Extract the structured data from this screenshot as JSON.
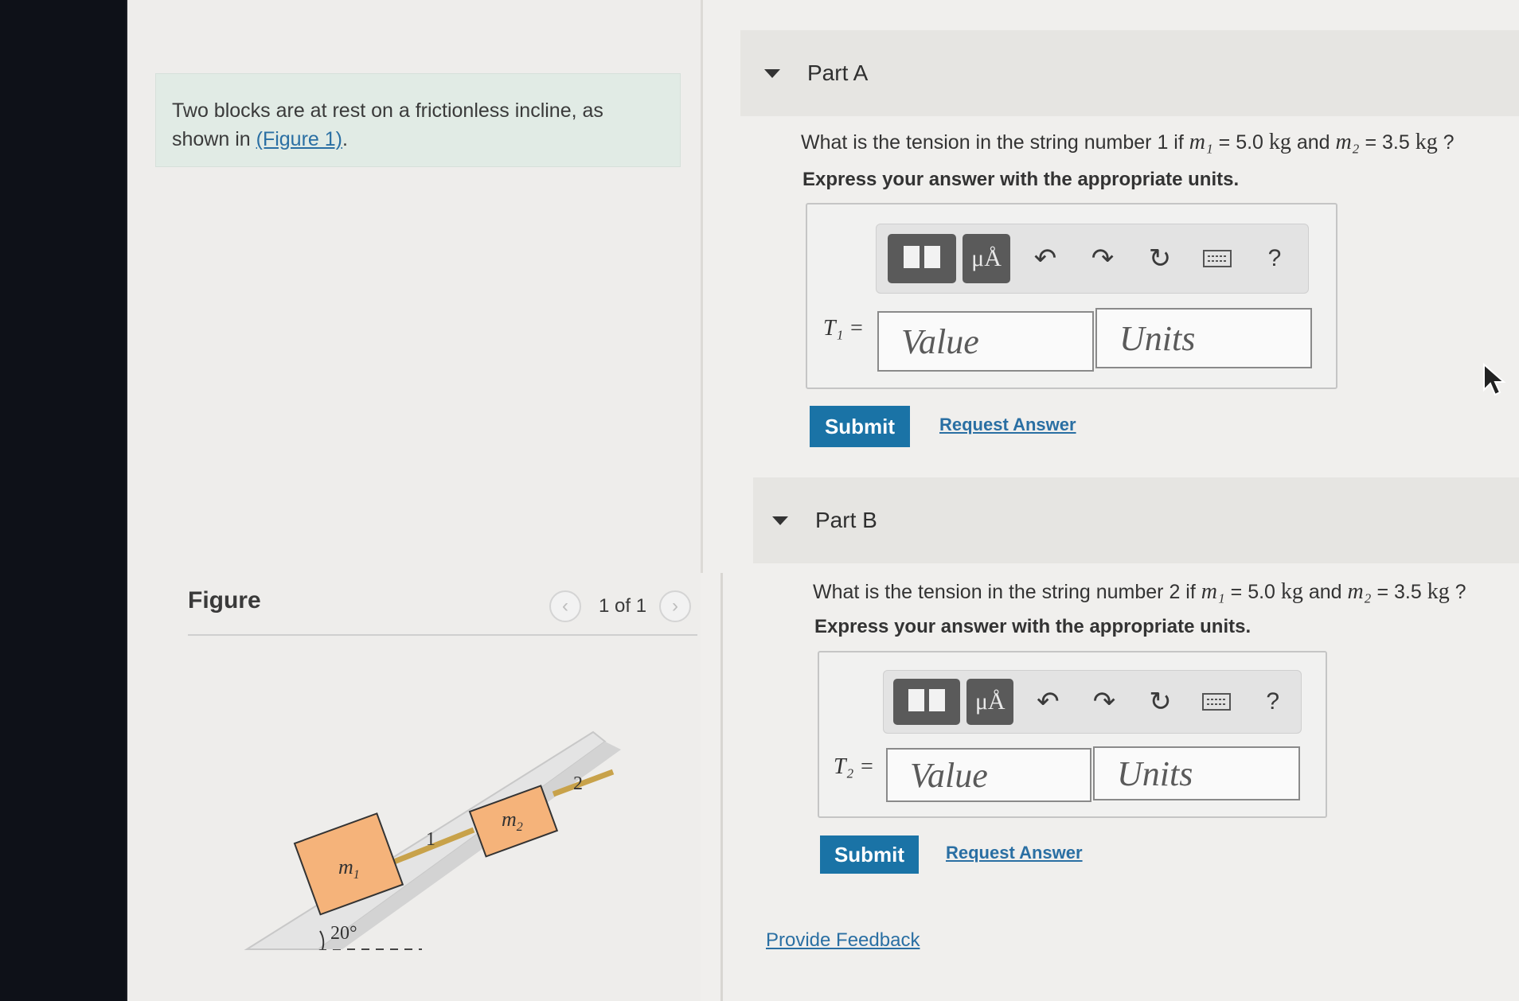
{
  "intro": {
    "text_before": "Two blocks are at rest on a frictionless incline, as shown in ",
    "link": "(Figure 1)",
    "text_after": "."
  },
  "figure": {
    "header": "Figure",
    "count": "1 of 1",
    "prev_icon": "chevron-left-icon",
    "next_icon": "chevron-right-icon",
    "labels": {
      "m1": "m",
      "m1_sub": "1",
      "m2": "m",
      "m2_sub": "2",
      "string1": "1",
      "string2": "2",
      "angle": "20°"
    },
    "colors": {
      "block": "#f5b37a",
      "block_edge": "#333333",
      "string": "#c8a24a",
      "incline": "#e6e6e6"
    }
  },
  "parts": [
    {
      "title": "Part A",
      "question_pre": "What is the tension in the string number 1 if ",
      "m1": "m₁",
      "eq1": " = 5.0 ",
      "unit1": "kg",
      "mid": " and ",
      "m2": "m₂",
      "eq2": " = 3.5 ",
      "unit2": "kg",
      "end": " ?",
      "instruction": "Express your answer with the appropriate units.",
      "var_label": "T₁ =",
      "value_placeholder": "Value",
      "units_placeholder": "Units",
      "submit": "Submit",
      "request": "Request Answer"
    },
    {
      "title": "Part B",
      "question_pre": "What is the tension in the string number 2 if ",
      "m1": "m₁",
      "eq1": " = 5.0 ",
      "unit1": "kg",
      "mid": " and ",
      "m2": "m₂",
      "eq2": " = 3.5 ",
      "unit2": "kg",
      "end": " ?",
      "instruction": "Express your answer with the appropriate units.",
      "var_label": "T₂ =",
      "value_placeholder": "Value",
      "units_placeholder": "Units",
      "submit": "Submit",
      "request": "Request Answer"
    }
  ],
  "toolbar": {
    "mu_label": "μÅ",
    "undo": "↶",
    "redo": "↷",
    "reset": "↻",
    "help": "?",
    "icons": [
      "templates-icon",
      "units-icon",
      "undo-icon",
      "redo-icon",
      "reset-icon",
      "keyboard-icon",
      "help-icon"
    ]
  },
  "feedback": "Provide Feedback",
  "colors": {
    "accent": "#1a73a6",
    "link": "#2a6fa3",
    "intro_bg": "#e1ebe5"
  }
}
